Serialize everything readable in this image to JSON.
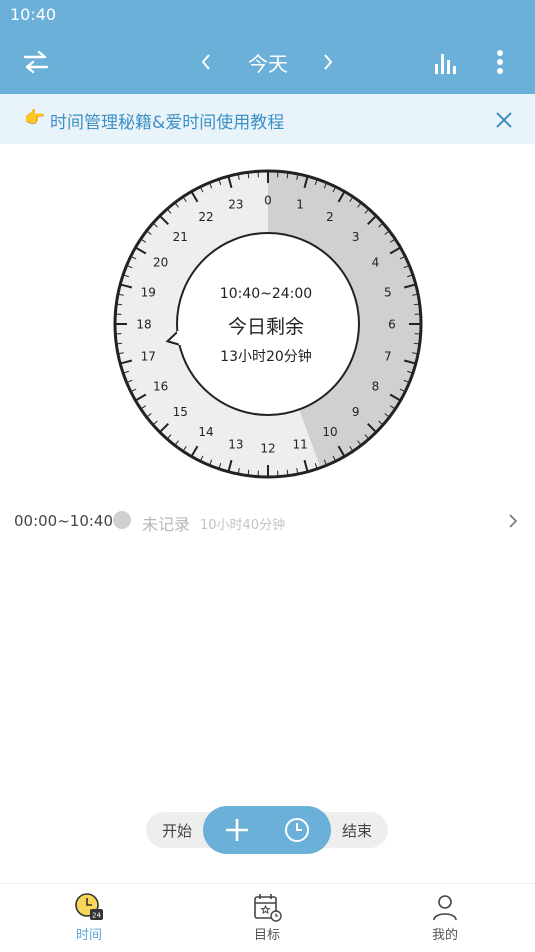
{
  "status_bar": {
    "time": "10:40"
  },
  "header": {
    "title": "今天"
  },
  "banner": {
    "hand": "👉",
    "text": "时间管理秘籍&爱时间使用教程"
  },
  "clock": {
    "hours": [
      "0",
      "1",
      "2",
      "3",
      "4",
      "5",
      "6",
      "7",
      "8",
      "9",
      "10",
      "11",
      "12",
      "13",
      "14",
      "15",
      "16",
      "17",
      "18",
      "19",
      "20",
      "21",
      "22",
      "23"
    ],
    "elapsed_until_hour": 10.6667,
    "center": {
      "range": "10:40~24:00",
      "label": "今日剩余",
      "duration": "13小时20分钟"
    }
  },
  "records": [
    {
      "range": "00:00~10:40",
      "label": "未记录",
      "duration": "10小时40分钟"
    }
  ],
  "action_bar": {
    "start_label": "开始",
    "end_label": "结束"
  },
  "tabs": [
    {
      "label": "时间",
      "active": true,
      "icon": "clock-24-icon"
    },
    {
      "label": "目标",
      "active": false,
      "icon": "goal-calendar-icon"
    },
    {
      "label": "我的",
      "active": false,
      "icon": "profile-icon"
    }
  ],
  "colors": {
    "accent": "#6ab0d8",
    "elapsed_sector": "#d0d0d0",
    "remaining_sector": "#eeeeee",
    "tab_active": "#5aa3d6",
    "tab_inactive": "#555555"
  }
}
